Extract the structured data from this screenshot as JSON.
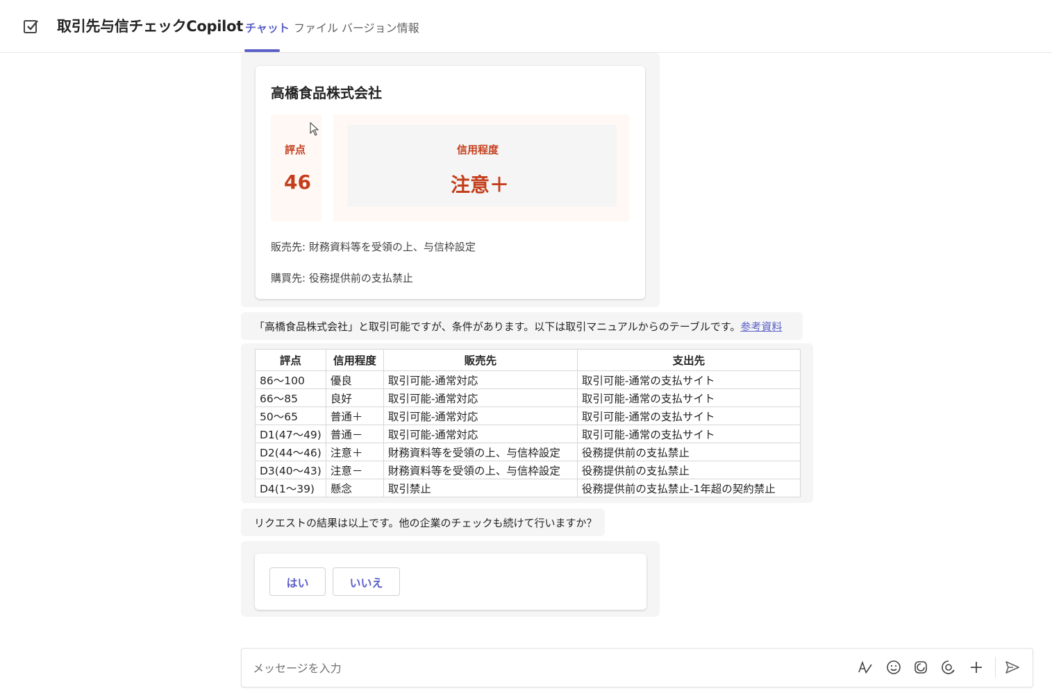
{
  "header": {
    "app_title": "取引先与信チェックCopilot",
    "tabs": [
      {
        "label": "チャット",
        "active": true
      },
      {
        "label": "ファイル",
        "active": false
      },
      {
        "label": "バージョン情報",
        "active": false
      }
    ],
    "accent_color": "#5b5fc7"
  },
  "result_card": {
    "company_name": "高橋食品株式会社",
    "score_label": "評点",
    "score_value": "46",
    "credit_label": "信用程度",
    "credit_value": "注意＋",
    "sales_note": "販売先: 財務資料等を受領の上、与信枠設定",
    "purchase_note": "購買先: 役務提供前の支払禁止",
    "highlight_color": "#c43e1c"
  },
  "message1": {
    "text": "「高橋食品株式会社」と取引可能ですが、条件があります。以下は取引マニュアルからのテーブルです。",
    "link_text": "参考資料"
  },
  "rules_table": {
    "headers": [
      "評点",
      "信用程度",
      "販売先",
      "支出先"
    ],
    "rows": [
      [
        "86～100",
        "優良",
        "取引可能-通常対応",
        "取引可能-通常の支払サイト"
      ],
      [
        "66～85",
        "良好",
        "取引可能-通常対応",
        "取引可能-通常の支払サイト"
      ],
      [
        "50～65",
        "普通＋",
        "取引可能-通常対応",
        "取引可能-通常の支払サイト"
      ],
      [
        "D1(47～49)",
        "普通－",
        "取引可能-通常対応",
        "取引可能-通常の支払サイト"
      ],
      [
        "D2(44～46)",
        "注意＋",
        "財務資料等を受領の上、与信枠設定",
        "役務提供前の支払禁止"
      ],
      [
        "D3(40～43)",
        "注意－",
        "財務資料等を受領の上、与信枠設定",
        "役務提供前の支払禁止"
      ],
      [
        "D4(1～39)",
        "懸念",
        "取引禁止",
        "役務提供前の支払禁止-1年超の契約禁止"
      ]
    ]
  },
  "message2": {
    "text": "リクエストの結果は以上です。他の企業のチェックも続けて行いますか？"
  },
  "choices": {
    "yes_label": "はい",
    "no_label": "いいえ"
  },
  "composer": {
    "placeholder": "メッセージを入力",
    "icons": [
      "format-icon",
      "emoji-icon",
      "loop-icon",
      "sticker-icon",
      "plus-icon",
      "send-icon"
    ]
  }
}
